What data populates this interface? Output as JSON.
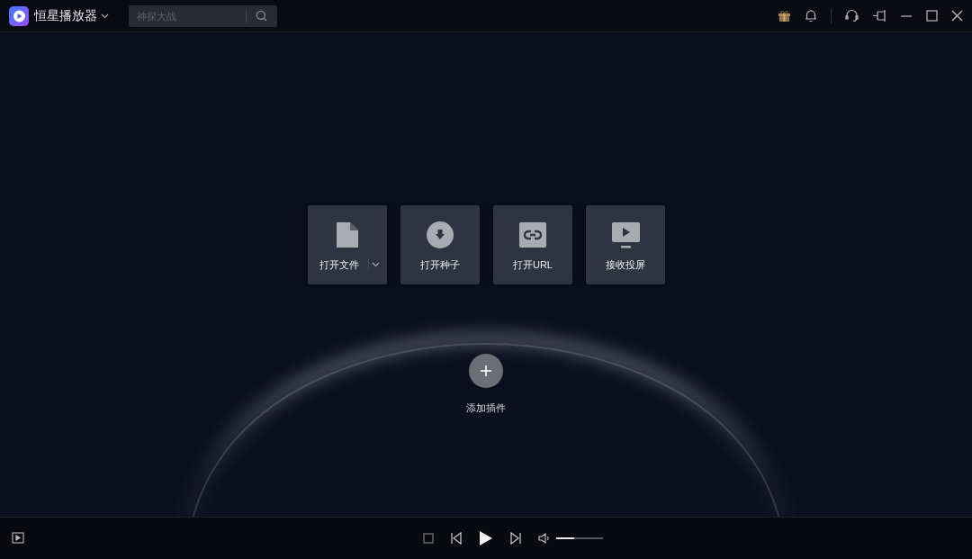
{
  "app": {
    "title": "恒星播放器"
  },
  "search": {
    "placeholder": "神探大战"
  },
  "tiles": [
    {
      "kind": "file",
      "label": "打开文件",
      "has_menu": true
    },
    {
      "kind": "torrent",
      "label": "打开种子",
      "has_menu": false
    },
    {
      "kind": "url",
      "label": "打开URL",
      "has_menu": false
    },
    {
      "kind": "cast",
      "label": "接收投屏",
      "has_menu": false
    }
  ],
  "plugin": {
    "label": "添加插件"
  },
  "player": {
    "volume": {
      "level": 0.38
    }
  }
}
